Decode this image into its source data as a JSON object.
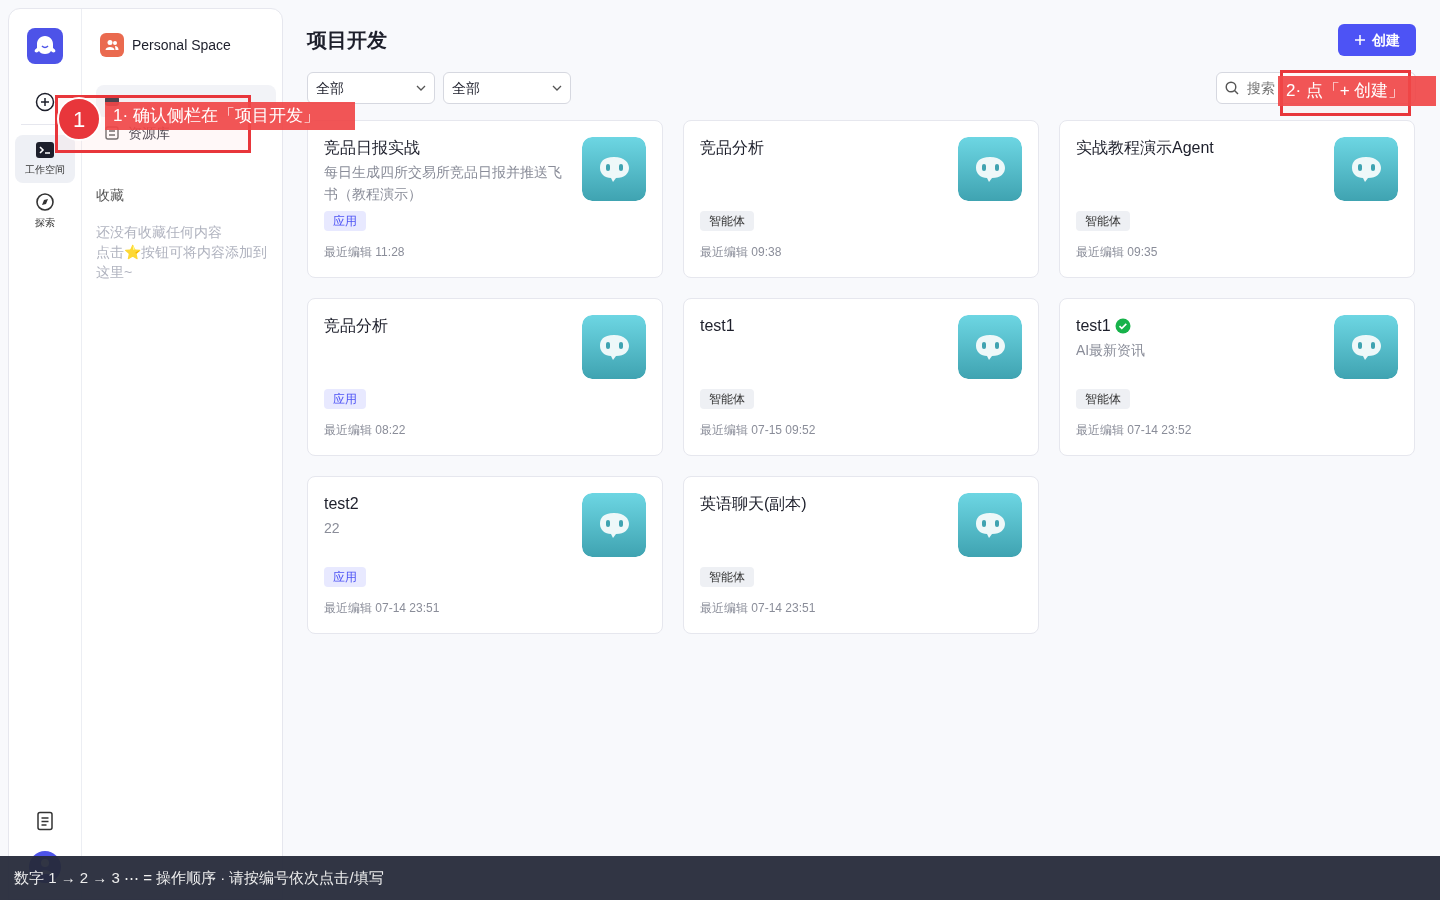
{
  "rail": {
    "items": [
      {
        "label": "工作空间",
        "kind": "workspace",
        "selected": true
      },
      {
        "label": "探索",
        "kind": "explore",
        "selected": false
      }
    ]
  },
  "sidebar": {
    "space_name": "Personal Space",
    "items": [
      {
        "kind": "project",
        "selected": true
      },
      {
        "label": "资源库",
        "kind": "library",
        "selected": false
      }
    ],
    "favorites": {
      "heading": "收藏",
      "empty_lines": [
        "还没有收藏任何内容",
        "点击⭐按钮可将内容添加到这里~"
      ]
    }
  },
  "page": {
    "title": "项目开发",
    "create_button": "创建",
    "filters": [
      {
        "value": "全部"
      },
      {
        "value": "全部"
      }
    ],
    "search": {
      "placeholder": "搜索"
    }
  },
  "cards": [
    {
      "title": "竞品日报实战",
      "verified": false,
      "description": "每日生成四所交易所竞品日报并推送飞书（教程演示）",
      "tag": {
        "label": "应用",
        "kind": "app"
      },
      "edited": "最近编辑 11:28"
    },
    {
      "title": "竞品分析",
      "verified": false,
      "tag": {
        "label": "智能体",
        "kind": "agent"
      },
      "edited": "最近编辑 09:38"
    },
    {
      "title": "实战教程演示Agent",
      "verified": false,
      "tag": {
        "label": "智能体",
        "kind": "agent"
      },
      "edited": "最近编辑 09:35"
    },
    {
      "title": "竞品分析",
      "verified": false,
      "tag": {
        "label": "应用",
        "kind": "app"
      },
      "edited": "最近编辑 08:22"
    },
    {
      "title": "test1",
      "verified": false,
      "tag": {
        "label": "智能体",
        "kind": "agent"
      },
      "edited": "最近编辑 07-15 09:52"
    },
    {
      "title": "test1",
      "verified": true,
      "description": "AI最新资讯",
      "tag": {
        "label": "智能体",
        "kind": "agent"
      },
      "edited": "最近编辑 07-14 23:52"
    },
    {
      "title": "test2",
      "verified": false,
      "description": "22",
      "tag": {
        "label": "应用",
        "kind": "app"
      },
      "edited": "最近编辑 07-14 23:51"
    },
    {
      "title": "英语聊天(副本)",
      "verified": false,
      "tag": {
        "label": "智能体",
        "kind": "agent"
      },
      "edited": "最近编辑 07-14 23:51"
    }
  ],
  "annotations": [
    {
      "number": "1",
      "text": "1·  确认侧栏在「项目开发」"
    },
    {
      "text": "2·  点「+ 创建」"
    }
  ],
  "guide_bar": "数字 1 → 2 → 3 ⋯ = 操作顺序 ·  请按编号依次点击/填写"
}
